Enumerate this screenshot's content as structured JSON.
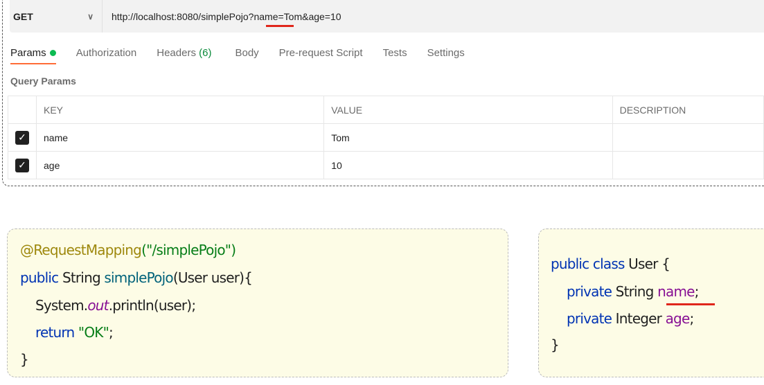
{
  "request": {
    "method": "GET",
    "url": "http://localhost:8080/simplePojo?name=Tom&age=10"
  },
  "tabs": [
    {
      "label": "Params"
    },
    {
      "label": "Authorization"
    },
    {
      "label": "Headers",
      "count": "(6)"
    },
    {
      "label": "Body"
    },
    {
      "label": "Pre-request Script"
    },
    {
      "label": "Tests"
    },
    {
      "label": "Settings"
    }
  ],
  "query_params": {
    "title": "Query Params",
    "columns": [
      "KEY",
      "VALUE",
      "DESCRIPTION"
    ],
    "rows": [
      {
        "key": "name",
        "value": "Tom",
        "description": "",
        "checked": true
      },
      {
        "key": "age",
        "value": "10",
        "description": "",
        "checked": true
      }
    ]
  },
  "controller_code": [
    "@RequestMapping",
    "(\"/simplePojo\")",
    "public",
    " String ",
    "simplePojo",
    "(User user){",
    "System.",
    "out",
    ".println(user);",
    "return",
    " \"OK\"",
    ";",
    "}"
  ],
  "user_code": [
    "public class",
    " User {",
    "private",
    " String ",
    "name",
    ";",
    "private",
    " Integer ",
    "age",
    ";",
    "}"
  ]
}
